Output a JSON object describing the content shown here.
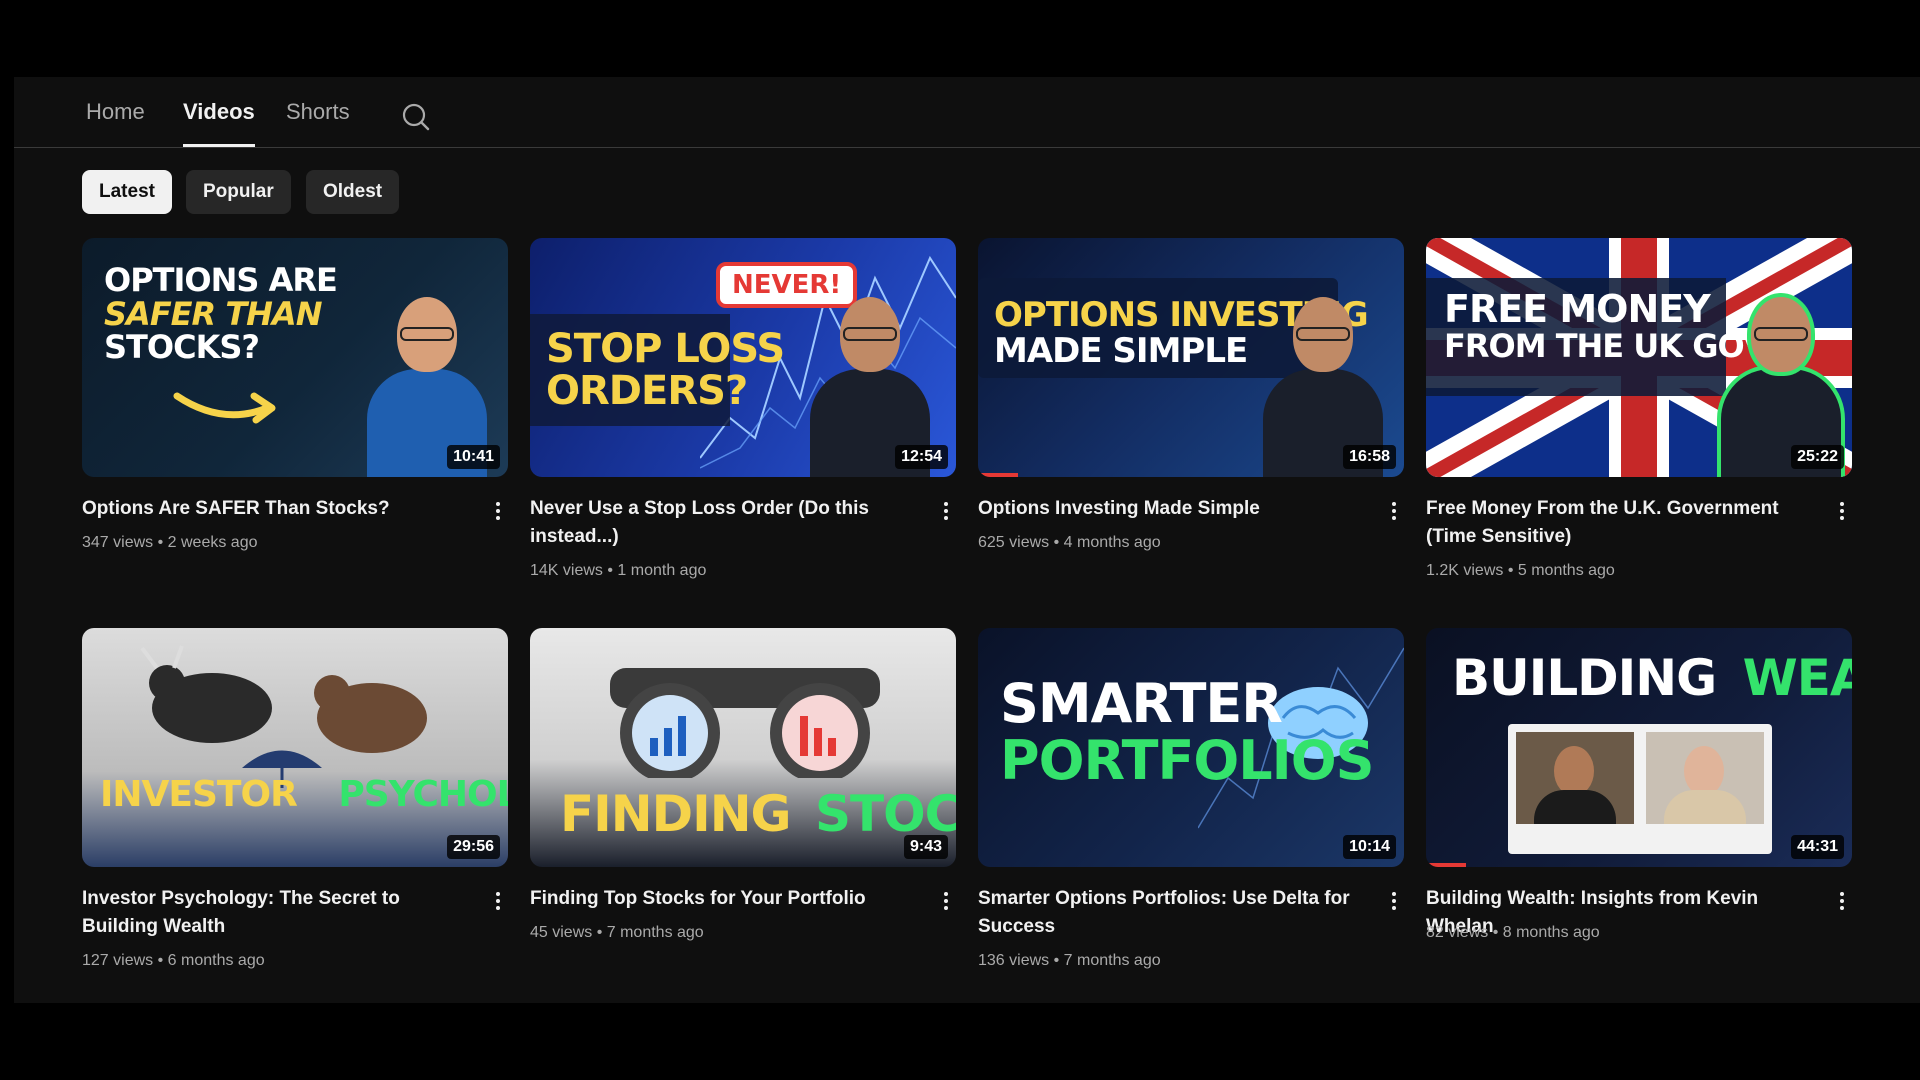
{
  "tabs": [
    {
      "label": "Home",
      "active": false
    },
    {
      "label": "Videos",
      "active": true
    },
    {
      "label": "Shorts",
      "active": false
    }
  ],
  "filters": [
    {
      "label": "Latest",
      "active": true
    },
    {
      "label": "Popular",
      "active": false
    },
    {
      "label": "Oldest",
      "active": false
    }
  ],
  "videos": [
    {
      "title": "Options Are SAFER Than Stocks?",
      "views": "347 views",
      "age": "2 weeks ago",
      "duration": "10:41",
      "thumb_lines": [
        "OPTIONS ARE",
        "SAFER THAN",
        "STOCKS?"
      ]
    },
    {
      "title": "Never Use a Stop Loss Order (Do this instead...)",
      "views": "14K views",
      "age": "1 month ago",
      "duration": "12:54",
      "thumb_lines": [
        "STOP LOSS",
        "ORDERS?"
      ],
      "thumb_badge": "NEVER!"
    },
    {
      "title": "Options Investing Made Simple",
      "views": "625 views",
      "age": "4 months ago",
      "duration": "16:58",
      "thumb_lines": [
        "OPTIONS INVESTING",
        "MADE SIMPLE"
      ]
    },
    {
      "title": "Free Money From the U.K. Government (Time Sensitive)",
      "views": "1.2K views",
      "age": "5 months ago",
      "duration": "25:22",
      "thumb_lines": [
        "FREE MONEY",
        "FROM THE UK GOV"
      ]
    },
    {
      "title": "Investor Psychology: The Secret to Building Wealth",
      "views": "127 views",
      "age": "6 months ago",
      "duration": "29:56",
      "thumb_lines": [
        "INVESTOR",
        "PSYCHOLOGY"
      ]
    },
    {
      "title": "Finding Top Stocks for Your Portfolio",
      "views": "45 views",
      "age": "7 months ago",
      "duration": "9:43",
      "thumb_lines": [
        "FINDING",
        "STOCKS"
      ]
    },
    {
      "title": "Smarter Options Portfolios: Use Delta for Success",
      "views": "136 views",
      "age": "7 months ago",
      "duration": "10:14",
      "thumb_lines": [
        "SMARTER",
        "PORTFOLIOS"
      ]
    },
    {
      "title": "Building Wealth: Insights from Kevin Whelan",
      "views": "82 views",
      "age": "8 months ago",
      "duration": "44:31",
      "thumb_lines": [
        "BUILDING",
        "WEALTH"
      ]
    }
  ],
  "colors": {
    "yellow": "#f6d34a",
    "green": "#34e36c",
    "red": "#e53935",
    "accent_text": "#f1f1f1",
    "muted_text": "#aaaaaa"
  },
  "icons": {
    "search": "search-icon",
    "more": "more-vert-icon"
  }
}
